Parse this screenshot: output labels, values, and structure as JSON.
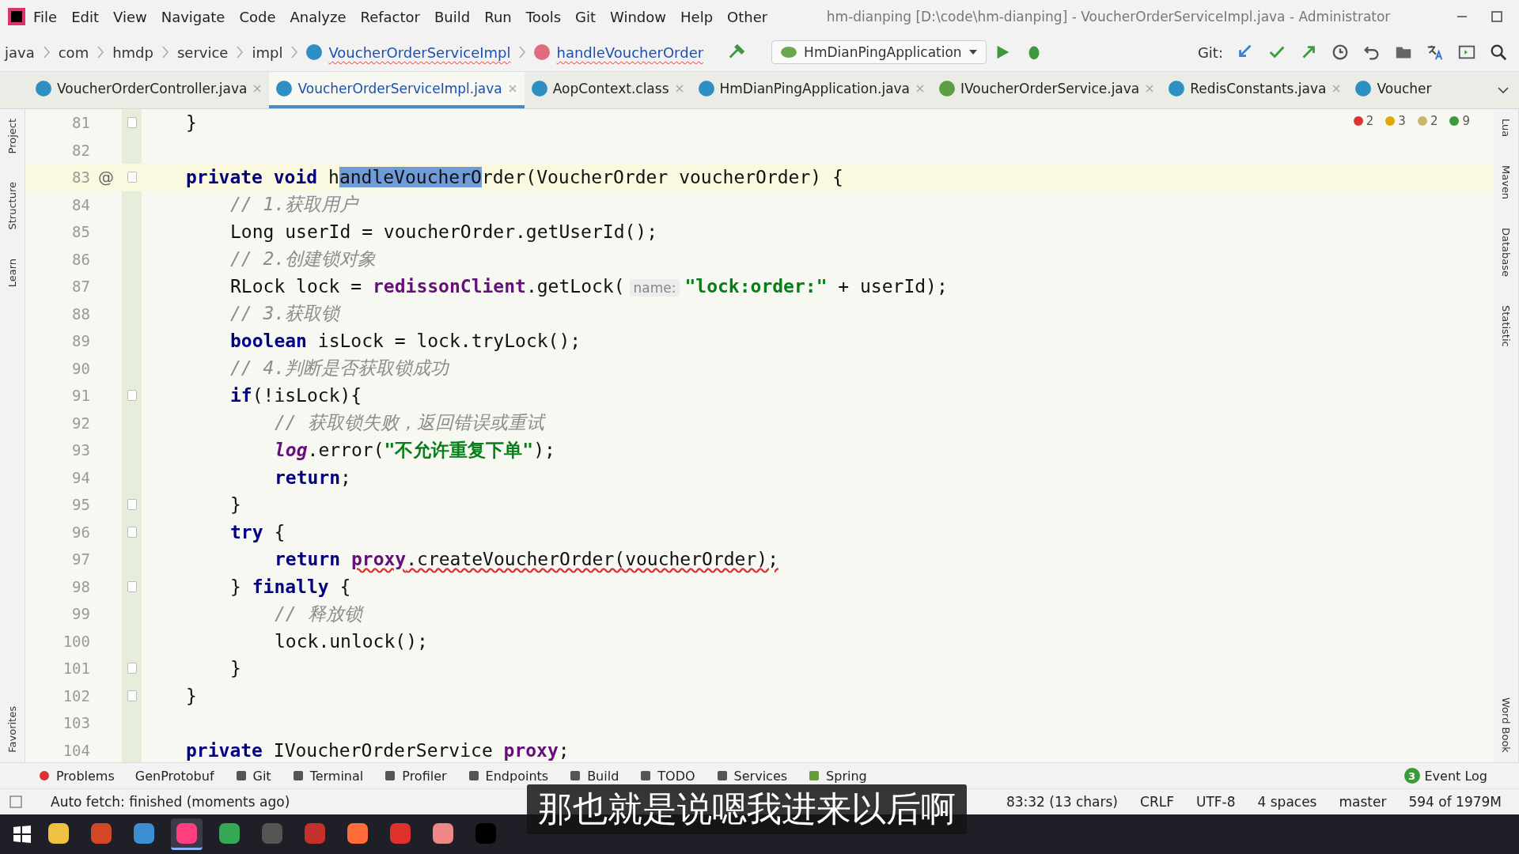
{
  "window": {
    "title": "hm-dianping [D:\\code\\hm-dianping] - VoucherOrderServiceImpl.java - Administrator",
    "menu": [
      "File",
      "Edit",
      "View",
      "Navigate",
      "Code",
      "Analyze",
      "Refactor",
      "Build",
      "Run",
      "Tools",
      "Git",
      "Window",
      "Help",
      "Other"
    ]
  },
  "breadcrumbs": [
    {
      "label": "java",
      "kind": "folder"
    },
    {
      "label": "com",
      "kind": "folder"
    },
    {
      "label": "hmdp",
      "kind": "folder"
    },
    {
      "label": "service",
      "kind": "folder"
    },
    {
      "label": "impl",
      "kind": "folder"
    },
    {
      "label": "VoucherOrderServiceImpl",
      "kind": "class"
    },
    {
      "label": "handleVoucherOrder",
      "kind": "method"
    }
  ],
  "toolbar": {
    "run_config": "HmDianPingApplication",
    "git_label": "Git:"
  },
  "tabs": [
    {
      "label": "VoucherOrderController.java",
      "kind": "class",
      "selected": false
    },
    {
      "label": "VoucherOrderServiceImpl.java",
      "kind": "class",
      "selected": true
    },
    {
      "label": "AopContext.class",
      "kind": "class",
      "selected": false
    },
    {
      "label": "HmDianPingApplication.java",
      "kind": "class",
      "selected": false
    },
    {
      "label": "IVoucherOrderService.java",
      "kind": "interface",
      "selected": false
    },
    {
      "label": "RedisConstants.java",
      "kind": "class",
      "selected": false
    },
    {
      "label": "Voucher",
      "kind": "class",
      "selected": false
    }
  ],
  "inspections": [
    {
      "kind": "error",
      "count": "2"
    },
    {
      "kind": "warning",
      "count": "3"
    },
    {
      "kind": "weak",
      "count": "2"
    },
    {
      "kind": "ok",
      "count": "9"
    }
  ],
  "left_tools": [
    "Project",
    "Structure",
    "Learn",
    "Favorites"
  ],
  "right_tools": [
    "Lua",
    "Maven",
    "Database",
    "Statistic",
    "Word Book"
  ],
  "editor": {
    "lines": [
      {
        "number": "81",
        "current": false,
        "fold": true,
        "tokens": [
          {
            "text": "}",
            "kind": "plain"
          }
        ]
      },
      {
        "number": "82",
        "current": false,
        "fold": false
      },
      {
        "number": "83",
        "current": true,
        "fold": true,
        "mark": "@",
        "tokens": [
          {
            "text": "private void ",
            "kind": "kw"
          },
          {
            "text": "h",
            "kind": "plain"
          },
          {
            "text": "andleVoucherO",
            "kind": "sel"
          },
          {
            "text": "rder(VoucherOrder voucherOrder) {",
            "kind": "plain"
          }
        ],
        "children": [
          {
            "number": "84",
            "current": false,
            "fold": false,
            "tokens": [
              {
                "text": "// 1.获取用户",
                "kind": "comment"
              }
            ]
          },
          {
            "number": "85",
            "current": false,
            "fold": false,
            "tokens": [
              {
                "text": "Long userId = voucherOrder.getUserId();",
                "kind": "plain"
              }
            ]
          },
          {
            "number": "86",
            "current": false,
            "fold": false,
            "tokens": [
              {
                "text": "// 2.创建锁对象",
                "kind": "comment"
              }
            ]
          },
          {
            "number": "87",
            "current": false,
            "fold": false,
            "tokens": [
              {
                "text": "RLock lock = ",
                "kind": "plain"
              },
              {
                "text": "redissonClient",
                "kind": "field"
              },
              {
                "text": ".getLock(",
                "kind": "plain"
              },
              {
                "text": "name:",
                "kind": "hint"
              },
              {
                "text": "\"lock:order:\"",
                "kind": "string"
              },
              {
                "text": " + userId);",
                "kind": "plain"
              }
            ]
          },
          {
            "number": "88",
            "current": false,
            "fold": false,
            "tokens": [
              {
                "text": "// 3.获取锁",
                "kind": "comment"
              }
            ]
          },
          {
            "number": "89",
            "current": false,
            "fold": false,
            "tokens": [
              {
                "text": "boolean",
                "kind": "kw"
              },
              {
                "text": " isLock = lock.tryLock();",
                "kind": "plain"
              }
            ]
          },
          {
            "number": "90",
            "current": false,
            "fold": false,
            "tokens": [
              {
                "text": "// 4.判断是否获取锁成功",
                "kind": "comment"
              }
            ]
          },
          {
            "number": "91",
            "current": false,
            "fold": true,
            "tokens": [
              {
                "text": "if",
                "kind": "kw"
              },
              {
                "text": "(!isLock){",
                "kind": "plain"
              }
            ],
            "children": [
              {
                "number": "92",
                "current": false,
                "fold": false,
                "tokens": [
                  {
                    "text": "// 获取锁失败，返回错误或重试",
                    "kind": "comment"
                  }
                ]
              },
              {
                "number": "93",
                "current": false,
                "fold": false,
                "tokens": [
                  {
                    "text": "log",
                    "kind": "logf"
                  },
                  {
                    "text": ".error(",
                    "kind": "plain"
                  },
                  {
                    "text": "\"不允许重复下单\"",
                    "kind": "string"
                  },
                  {
                    "text": ");",
                    "kind": "plain"
                  }
                ]
              },
              {
                "number": "94",
                "current": false,
                "fold": false,
                "tokens": [
                  {
                    "text": "return",
                    "kind": "kw"
                  },
                  {
                    "text": ";",
                    "kind": "plain"
                  }
                ]
              }
            ]
          },
          {
            "number": "95",
            "current": false,
            "fold": true,
            "tokens": [
              {
                "text": "}",
                "kind": "plain"
              }
            ]
          },
          {
            "number": "96",
            "current": false,
            "fold": true,
            "tokens": [
              {
                "text": "try",
                "kind": "kw"
              },
              {
                "text": " {",
                "kind": "plain"
              }
            ],
            "children": [
              {
                "number": "97",
                "current": false,
                "fold": false,
                "tokens": [
                  {
                    "text": "return ",
                    "kind": "kw"
                  },
                  {
                    "text": "proxy",
                    "kind": "errfield"
                  },
                  {
                    "text": ".createVoucherOrder(voucherOrder);",
                    "kind": "err"
                  }
                ]
              }
            ]
          },
          {
            "number": "98",
            "current": false,
            "fold": true,
            "tokens": [
              {
                "text": "} ",
                "kind": "plain"
              },
              {
                "text": "finally",
                "kind": "kw"
              },
              {
                "text": " {",
                "kind": "plain"
              }
            ],
            "children": [
              {
                "number": "99",
                "current": false,
                "fold": false,
                "tokens": [
                  {
                    "text": "// 释放锁",
                    "kind": "comment"
                  }
                ]
              },
              {
                "number": "100",
                "current": false,
                "fold": false,
                "tokens": [
                  {
                    "text": "lock.unlock();",
                    "kind": "plain"
                  }
                ]
              }
            ]
          },
          {
            "number": "101",
            "current": false,
            "fold": true,
            "tokens": [
              {
                "text": "}",
                "kind": "plain"
              }
            ]
          }
        ]
      },
      {
        "number": "102",
        "current": false,
        "fold": true,
        "tokens": [
          {
            "text": "}",
            "kind": "plain"
          }
        ]
      },
      {
        "number": "103",
        "current": false,
        "fold": false
      },
      {
        "number": "104",
        "current": false,
        "fold": false,
        "tokens": [
          {
            "text": "private",
            "kind": "kw"
          },
          {
            "text": " IVoucherOrderService ",
            "kind": "plain"
          },
          {
            "text": "proxy",
            "kind": "field"
          },
          {
            "text": ";",
            "kind": "plain"
          }
        ]
      }
    ]
  },
  "bottom_tools": [
    {
      "label": "Problems",
      "kind": "problems"
    },
    {
      "label": "GenProtobuf",
      "kind": "none"
    },
    {
      "label": "Git",
      "kind": "git"
    },
    {
      "label": "Terminal",
      "kind": "terminal"
    },
    {
      "label": "Profiler",
      "kind": "profiler"
    },
    {
      "label": "Endpoints",
      "kind": "endpoints"
    },
    {
      "label": "Build",
      "kind": "build"
    },
    {
      "label": "TODO",
      "kind": "todo"
    },
    {
      "label": "Services",
      "kind": "services"
    },
    {
      "label": "Spring",
      "kind": "spring"
    }
  ],
  "event_log": {
    "label": "Event Log",
    "count": "3"
  },
  "status_bar": {
    "message": "Auto fetch: finished (moments ago)",
    "items": [
      "83:32 (13 chars)",
      "CRLF",
      "UTF-8",
      "4 spaces",
      "master",
      "594 of 1979M"
    ]
  },
  "taskbar": {
    "apps": [
      {
        "kind": "explorer",
        "selected": false
      },
      {
        "kind": "slides",
        "selected": false
      },
      {
        "kind": "browser-alt",
        "selected": false
      },
      {
        "kind": "ide",
        "selected": true
      },
      {
        "kind": "browser",
        "selected": false
      },
      {
        "kind": "terminal",
        "selected": false
      },
      {
        "kind": "redis",
        "selected": false
      },
      {
        "kind": "postman",
        "selected": false
      },
      {
        "kind": "pen",
        "selected": false
      },
      {
        "kind": "draw",
        "selected": false
      },
      {
        "kind": "console",
        "selected": false
      }
    ]
  },
  "subtitle": "那也就是说嗯我进来以后啊"
}
